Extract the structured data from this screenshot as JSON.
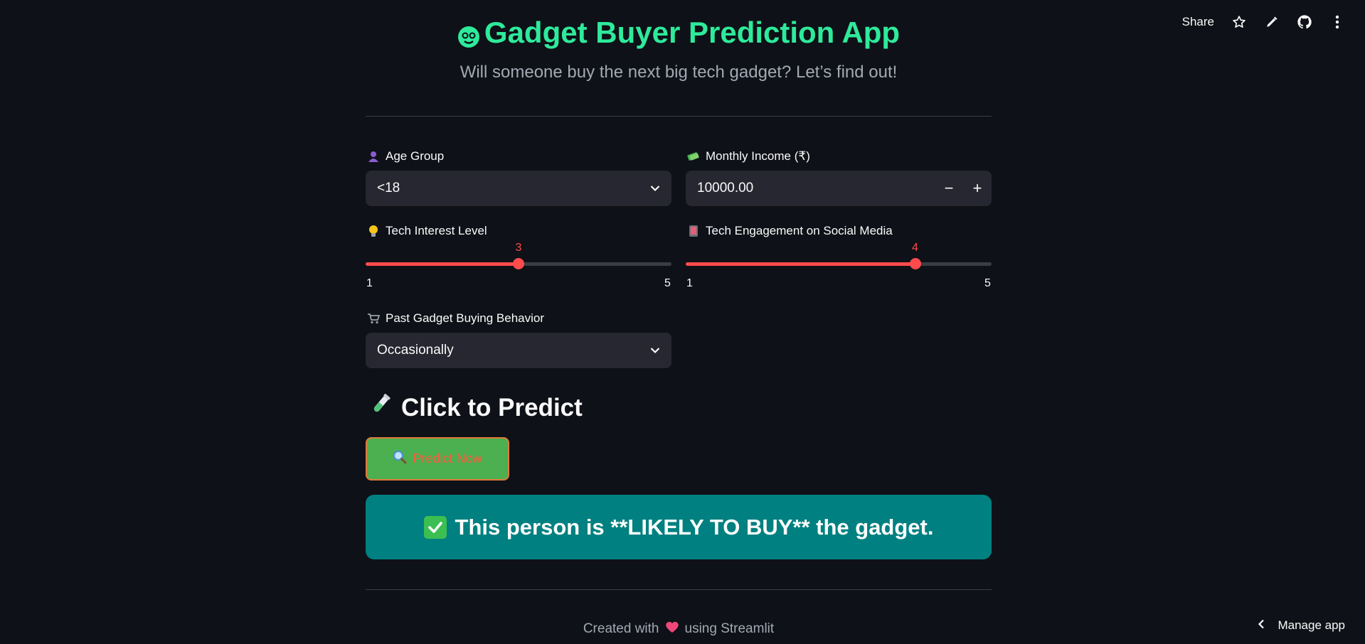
{
  "toolbar": {
    "share_label": "Share",
    "icons": [
      "star-icon",
      "pencil-icon",
      "github-icon",
      "more-vertical-icon"
    ]
  },
  "header": {
    "title": "Gadget Buyer Prediction App",
    "title_icon": "nerd-face-icon",
    "subtitle": "Will someone buy the next big tech gadget? Let’s find out!",
    "title_color": "#2eea9b"
  },
  "form": {
    "age_group": {
      "label": "Age Group",
      "icon": "person-icon",
      "value": "<18"
    },
    "monthly_income": {
      "label": "Monthly Income (₹)",
      "icon": "money-icon",
      "value": "10000.00",
      "minus": "−",
      "plus": "+"
    },
    "tech_interest": {
      "label": "Tech Interest Level",
      "icon": "lightbulb-icon",
      "value": "3",
      "min": "1",
      "max": "5",
      "fraction": 0.5
    },
    "social_engagement": {
      "label": "Tech Engagement on Social Media",
      "icon": "phone-icon",
      "value": "4",
      "min": "1",
      "max": "5",
      "fraction": 0.75
    },
    "past_behavior": {
      "label": "Past Gadget Buying Behavior",
      "icon": "cart-icon",
      "value": "Occasionally"
    }
  },
  "predict": {
    "heading": "Click to Predict",
    "heading_icon": "test-tube-icon",
    "button_label": "Predict Now",
    "button_icon": "magnifier-icon"
  },
  "result": {
    "text": "This person is **LIKELY TO BUY** the gadget.",
    "icon": "check-mark-icon"
  },
  "footer": {
    "before": "Created with",
    "after": "using Streamlit",
    "icon": "heart-icon"
  },
  "manage": {
    "label": "Manage app"
  },
  "colors": {
    "accent": "#ff4b4b",
    "background": "#0e1117",
    "result_bg": "#008080",
    "button_bg": "#4caf50"
  }
}
